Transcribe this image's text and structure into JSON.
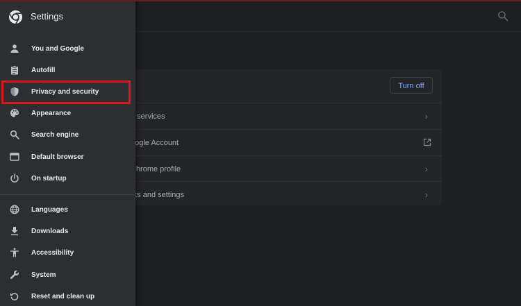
{
  "app": {
    "title": "Settings"
  },
  "colors": {
    "sidebar_bg": "#2d2e31",
    "main_bg": "#1e1f22",
    "text": "#e8eaed",
    "link_blue": "#7cacf8",
    "highlight_red": "#e0141b"
  },
  "sidebar": {
    "items": [
      {
        "label": "You and Google",
        "icon": "person-icon"
      },
      {
        "label": "Autofill",
        "icon": "clipboard-icon"
      },
      {
        "label": "Privacy and security",
        "icon": "shield-icon"
      },
      {
        "label": "Appearance",
        "icon": "palette-icon"
      },
      {
        "label": "Search engine",
        "icon": "search-icon"
      },
      {
        "label": "Default browser",
        "icon": "browser-icon"
      },
      {
        "label": "On startup",
        "icon": "power-icon"
      },
      {
        "label": "Languages",
        "icon": "globe-icon"
      },
      {
        "label": "Downloads",
        "icon": "download-icon"
      },
      {
        "label": "Accessibility",
        "icon": "accessibility-icon"
      },
      {
        "label": "System",
        "icon": "wrench-icon"
      },
      {
        "label": "Reset and clean up",
        "icon": "reset-icon"
      }
    ]
  },
  "main": {
    "turn_off_label": "Turn off",
    "rows": [
      {
        "label": "e services",
        "icon": "chevron-right-icon"
      },
      {
        "label": "oogle Account",
        "icon": "external-link-icon"
      },
      {
        "label": "Chrome profile",
        "icon": "chevron-right-icon"
      },
      {
        "label": "rks and settings",
        "icon": "chevron-right-icon"
      }
    ]
  }
}
